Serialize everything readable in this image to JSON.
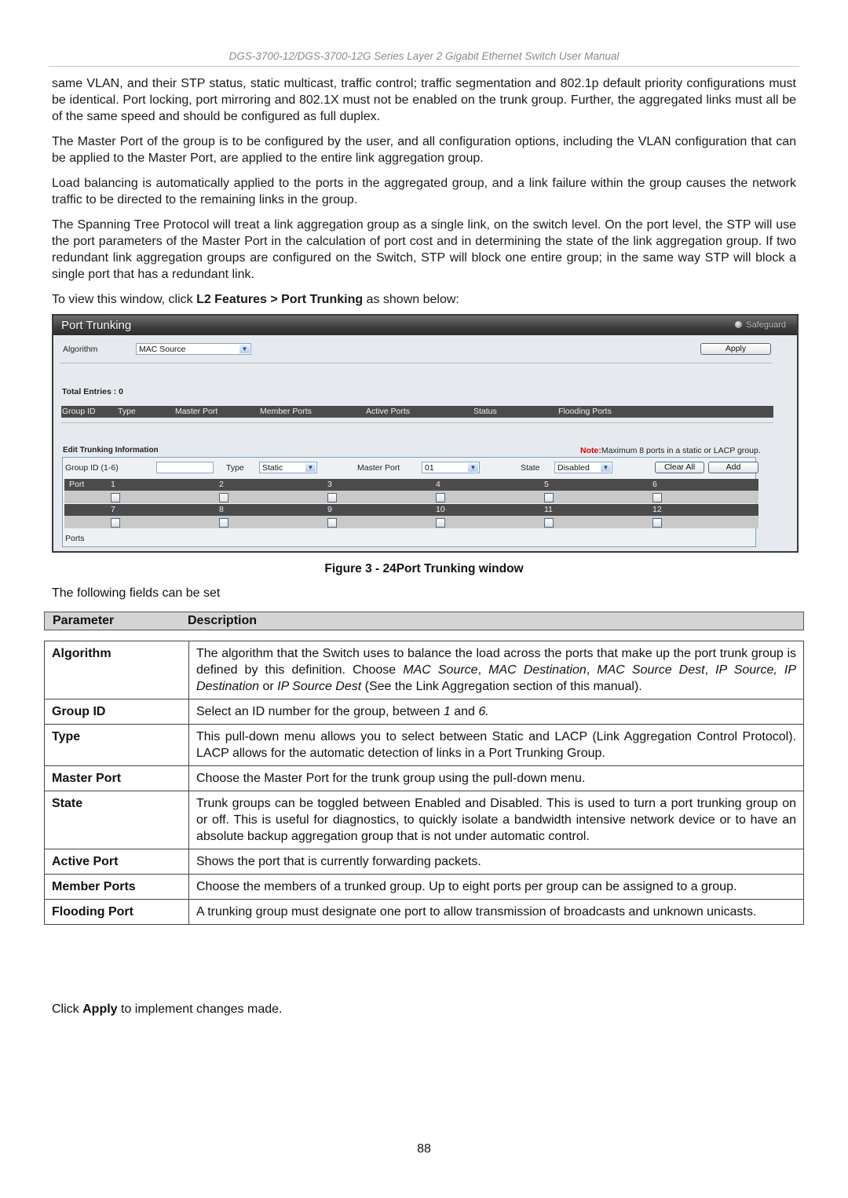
{
  "header": {
    "title": "DGS-3700-12/DGS-3700-12G Series Layer 2 Gigabit Ethernet Switch User Manual"
  },
  "body": {
    "paragraphs": [
      "same VLAN, and their STP status, static multicast, traffic control; traffic segmentation and 802.1p default priority configurations must be identical. Port locking, port mirroring and 802.1X must not be enabled on the trunk group. Further, the aggregated links must all be of the same speed and should be configured as full duplex.",
      "The Master Port of the group is to be configured by the user, and all configuration options, including the VLAN configuration that can be applied to the Master Port, are applied to the entire link aggregation group.",
      "Load balancing is automatically applied to the ports in the aggregated group, and a link failure within the group causes the network traffic to be directed to the remaining links in the group.",
      "The Spanning Tree Protocol will treat a link aggregation group as a single link, on the switch level. On the port level, the STP will use the port parameters of the Master Port in the calculation of port cost and in determining the state of the link aggregation group. If two redundant link aggregation groups are configured on the Switch, STP will block one entire group; in the same way STP will block a single port that has a redundant link."
    ],
    "nav_prefix": "To view this window, click ",
    "nav_path_1": "L2 Features",
    "nav_sep": " > ",
    "nav_path_2": "Port Trunking",
    "nav_suffix": " as shown below:"
  },
  "widget": {
    "title": "Port Trunking",
    "safeguard_label": "Safeguard",
    "algorithm_label": "Algorithm",
    "algorithm_value": "MAC Source",
    "apply_label": "Apply",
    "total_entries": "Total Entries : 0",
    "list_columns": [
      "Group ID",
      "Type",
      "Master Port",
      "Member Ports",
      "Active Ports",
      "Status",
      "Flooding Ports"
    ],
    "edit_title": "Edit Trunking Information",
    "note_label": "Note:",
    "note_text": "Maximum 8 ports in a static or LACP group.",
    "group_id_label": "Group ID (1-6)",
    "group_id_value": "",
    "type_label": "Type",
    "type_value": "Static",
    "master_port_label": "Master Port",
    "master_port_value": "01",
    "state_label": "State",
    "state_value": "Disabled",
    "clear_all_label": "Clear All",
    "add_label": "Add",
    "port_label": "Port",
    "port_rows": [
      [
        "1",
        "2",
        "3",
        "4",
        "5",
        "6"
      ],
      [
        "7",
        "8",
        "9",
        "10",
        "11",
        "12"
      ]
    ],
    "ports_footer": "Ports"
  },
  "figure_caption": "Figure 3 - 24Port Trunking window",
  "intro": "The following fields can be set",
  "table": {
    "headers": [
      "Parameter",
      "Description"
    ],
    "rows": [
      {
        "name": "Algorithm",
        "desc_html": "The algorithm that the Switch uses to balance the load across the ports that make up the port trunk group is defined by this definition. Choose <i>MAC Source</i>, <i>MAC Destination</i>, <i>MAC Source Dest</i>, <i>IP Source, IP Destination</i> or <i>IP Source Dest</i> (See the Link Aggregation section of this manual)."
      },
      {
        "name": "Group ID",
        "desc_html": "Select an ID number for the group, between <i>1</i> and <i>6.</i>"
      },
      {
        "name": "Type",
        "desc_html": "This pull-down menu allows you to select between Static and LACP (Link Aggregation Control Protocol). LACP allows for the automatic detection of links in a Port Trunking Group."
      },
      {
        "name": "Master Port",
        "desc_html": "Choose the Master Port for the trunk group using the pull-down menu."
      },
      {
        "name": "State",
        "desc_html": "Trunk groups can be toggled between Enabled and Disabled. This is used to turn a port trunking group on or off. This is useful for diagnostics, to quickly isolate a bandwidth intensive network device or to have an absolute backup aggregation group that is not under automatic control."
      },
      {
        "name": "Active Port",
        "desc_html": "Shows the port that is currently forwarding packets."
      },
      {
        "name": "Member Ports",
        "desc_html": "Choose the members of a trunked group. Up to eight ports per group can be assigned to a group."
      },
      {
        "name": "Flooding Port",
        "desc_html": "A trunking group must designate one port to allow transmission of broadcasts and unknown unicasts."
      }
    ]
  },
  "outro_prefix": "Click ",
  "outro_bold": "Apply",
  "outro_suffix": " to implement changes made.",
  "page_number": "88",
  "colors": {
    "note_red": "#e00000",
    "widget_bg": "#e6eaee",
    "bar_dark": "#4b4b4b",
    "row_gray": "#c9c9c9"
  }
}
